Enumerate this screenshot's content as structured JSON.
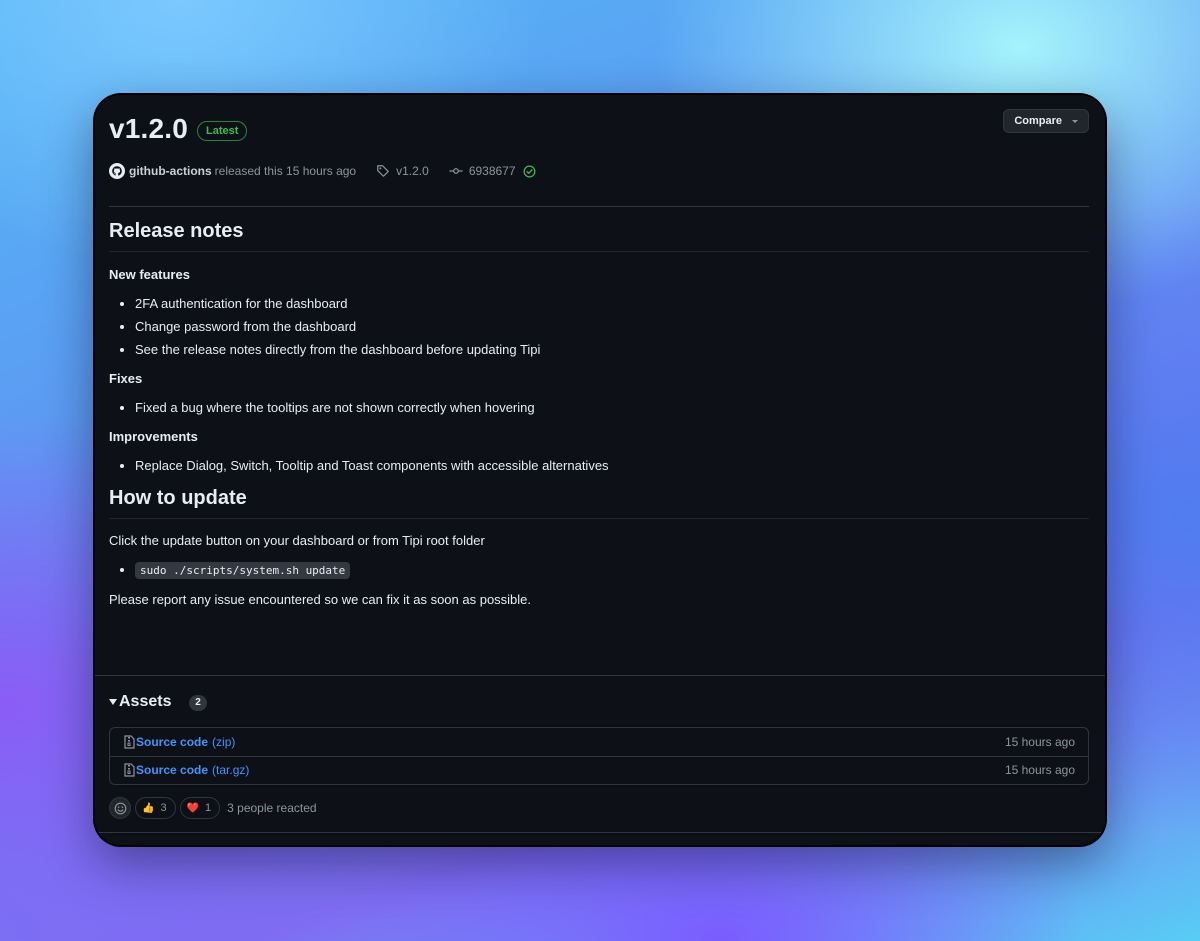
{
  "release": {
    "version": "v1.2.0",
    "latest_badge": "Latest",
    "compare_label": "Compare",
    "author": "github-actions",
    "released_text": "released this 15 hours ago",
    "tag": "v1.2.0",
    "commit": "6938677"
  },
  "notes": {
    "heading_release": "Release notes",
    "new_features_heading": "New features",
    "new_features": [
      "2FA authentication for the dashboard",
      "Change password from the dashboard",
      "See the release notes directly from the dashboard before updating Tipi"
    ],
    "fixes_heading": "Fixes",
    "fixes": [
      "Fixed a bug where the tooltips are not shown correctly when hovering"
    ],
    "improvements_heading": "Improvements",
    "improvements": [
      "Replace Dialog, Switch, Tooltip and Toast components with accessible alternatives"
    ],
    "heading_update": "How to update",
    "update_intro": "Click the update button on your dashboard or from Tipi root folder",
    "update_command": "sudo ./scripts/system.sh update",
    "closing": "Please report any issue encountered so we can fix it as soon as possible."
  },
  "assets": {
    "title": "Assets",
    "count": "2",
    "items": [
      {
        "label": "Source code",
        "ext": "(zip)",
        "time": "15 hours ago"
      },
      {
        "label": "Source code",
        "ext": "(tar.gz)",
        "time": "15 hours ago"
      }
    ]
  },
  "reactions": {
    "items": [
      {
        "emoji": "👍",
        "count": "3"
      },
      {
        "emoji": "❤️",
        "count": "1"
      }
    ],
    "summary": "3 people reacted"
  },
  "colors": {
    "background": "#0d1117",
    "link": "#4493f8",
    "success": "#3fb950",
    "muted": "#8b949e"
  }
}
